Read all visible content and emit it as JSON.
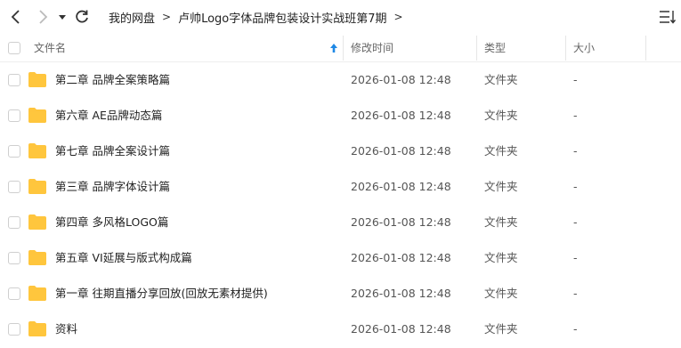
{
  "breadcrumb": {
    "items": [
      "我的网盘",
      "卢帅Logo字体品牌包装设计实战班第7期"
    ],
    "separator": ">"
  },
  "columns": {
    "name": "文件名",
    "modified": "修改时间",
    "type": "类型",
    "size": "大小"
  },
  "files": [
    {
      "name": "第二章 品牌全案策略篇",
      "modified": "2026-01-08 12:48",
      "type": "文件夹",
      "size": "-"
    },
    {
      "name": "第六章 AE品牌动态篇",
      "modified": "2026-01-08 12:48",
      "type": "文件夹",
      "size": "-"
    },
    {
      "name": "第七章 品牌全案设计篇",
      "modified": "2026-01-08 12:48",
      "type": "文件夹",
      "size": "-"
    },
    {
      "name": "第三章 品牌字体设计篇",
      "modified": "2026-01-08 12:48",
      "type": "文件夹",
      "size": "-"
    },
    {
      "name": "第四章 多风格LOGO篇",
      "modified": "2026-01-08 12:48",
      "type": "文件夹",
      "size": "-"
    },
    {
      "name": "第五章 VI延展与版式构成篇",
      "modified": "2026-01-08 12:48",
      "type": "文件夹",
      "size": "-"
    },
    {
      "name": "第一章 往期直播分享回放(回放无素材提供)",
      "modified": "2026-01-08 12:48",
      "type": "文件夹",
      "size": "-"
    },
    {
      "name": "资料",
      "modified": "2026-01-08 12:48",
      "type": "文件夹",
      "size": "-"
    }
  ],
  "colors": {
    "folder": "#ffc53d",
    "sort_arrow": "#1e88e5",
    "text": "#222222"
  }
}
